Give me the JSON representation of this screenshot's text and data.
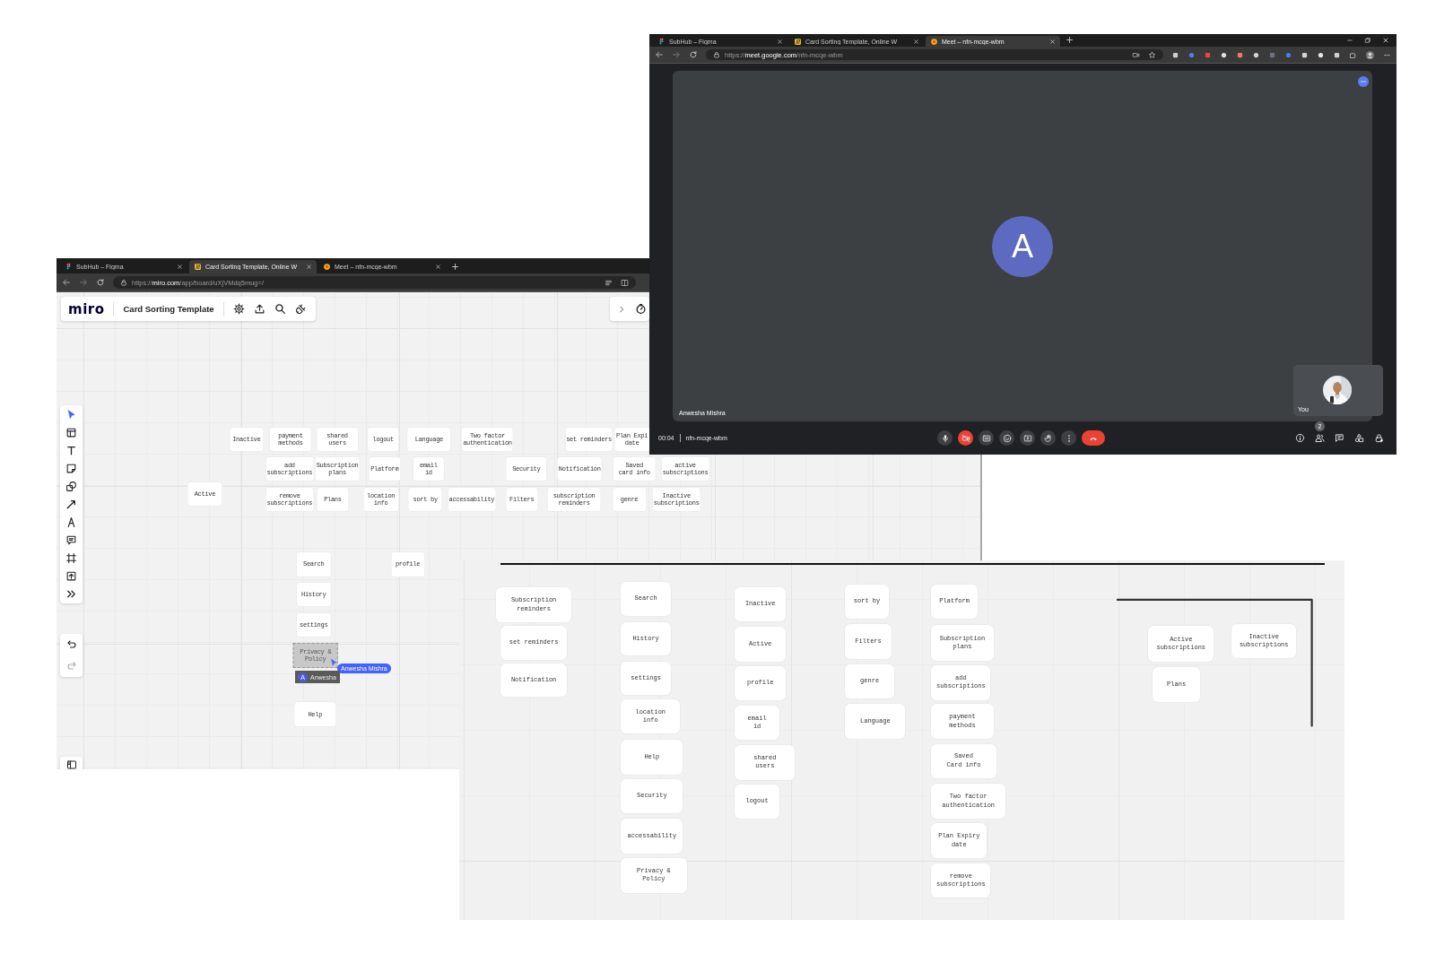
{
  "miro_window": {
    "tabs": [
      {
        "title": "SubHub – Figma",
        "selected": false
      },
      {
        "title": "Card Sorting Template, Online W",
        "selected": true
      },
      {
        "title": "Meet – nfn-mcqe-wbm",
        "selected": false
      }
    ],
    "address": {
      "scheme": "https://",
      "host": "miro.com",
      "path": "/app/board/uXjVMdq5mug=/"
    },
    "logo": "miro",
    "board_title": "Card Sorting Template",
    "cards": [
      {
        "text": "Inactive",
        "selected": false
      },
      {
        "text": "payment\nmethods",
        "selected": false
      },
      {
        "text": "shared\nusers",
        "selected": false
      },
      {
        "text": "logout",
        "selected": false
      },
      {
        "text": "Language",
        "selected": false
      },
      {
        "text": "Two factor\nauthentication",
        "selected": false
      },
      {
        "text": "set reminders",
        "selected": false
      },
      {
        "text": "Plan Expi\ndate",
        "selected": false
      },
      {
        "text": "add\nsubscriptions",
        "selected": false
      },
      {
        "text": "Subscription\nplans",
        "selected": false
      },
      {
        "text": "Platform",
        "selected": false
      },
      {
        "text": "email\nid",
        "selected": false
      },
      {
        "text": "Security",
        "selected": false
      },
      {
        "text": "Notification",
        "selected": false
      },
      {
        "text": "Saved\ncard info",
        "selected": false
      },
      {
        "text": "active\nsubscriptions",
        "selected": false
      },
      {
        "text": "Active",
        "selected": false
      },
      {
        "text": "remove\nsubscriptions",
        "selected": false
      },
      {
        "text": "Plans",
        "selected": false
      },
      {
        "text": "location\ninfo",
        "selected": false
      },
      {
        "text": "sort by",
        "selected": false
      },
      {
        "text": "accessability",
        "selected": false
      },
      {
        "text": "Filters",
        "selected": false
      },
      {
        "text": "subscription\nreminders",
        "selected": false
      },
      {
        "text": "genre",
        "selected": false
      },
      {
        "text": "Inactive\nsubscriptions",
        "selected": false
      },
      {
        "text": "Search",
        "selected": false
      },
      {
        "text": "profile",
        "selected": false
      },
      {
        "text": "History",
        "selected": false
      },
      {
        "text": "settings",
        "selected": false
      },
      {
        "text": "Privacy &\nPolicy",
        "selected": true
      },
      {
        "text": "Help",
        "selected": false
      }
    ],
    "collaborator_cursor": {
      "name": "Anwesha Mishra"
    },
    "collaborator_tag": {
      "initial": "A",
      "name": "Anwesha"
    }
  },
  "meet_window": {
    "tabs": [
      {
        "title": "SubHub – Figma",
        "selected": false
      },
      {
        "title": "Card Sorting Template, Online W",
        "selected": false
      },
      {
        "title": "Meet – nfn-mcqe-wbm",
        "selected": true
      }
    ],
    "address": {
      "scheme": "https://",
      "host": "meet.google.com",
      "path": "/nfn-mcqe-wbm"
    },
    "participant": {
      "initial": "A",
      "name": "Anwesha Mishra"
    },
    "self_tile": {
      "label": "You"
    },
    "time": "00:04",
    "meeting_code": "nfn-mcqe-wbm",
    "camera_on": false,
    "people_count": "2"
  },
  "sorted_board": {
    "cards": [
      {
        "text": "Subscription\nreminders"
      },
      {
        "text": "set reminders"
      },
      {
        "text": "Notification"
      },
      {
        "text": "Search"
      },
      {
        "text": "History"
      },
      {
        "text": "settings"
      },
      {
        "text": "location\ninfo"
      },
      {
        "text": "Help"
      },
      {
        "text": "Security"
      },
      {
        "text": "accessability"
      },
      {
        "text": "Privacy &\nPolicy"
      },
      {
        "text": "Inactive"
      },
      {
        "text": "Active"
      },
      {
        "text": "profile"
      },
      {
        "text": "email\nid"
      },
      {
        "text": "shared\nusers"
      },
      {
        "text": "logout"
      },
      {
        "text": "sort by"
      },
      {
        "text": "Filters"
      },
      {
        "text": "genre"
      },
      {
        "text": "Language"
      },
      {
        "text": "Platform"
      },
      {
        "text": "Subscription\nplans"
      },
      {
        "text": "add\nsubscriptions"
      },
      {
        "text": "payment\nmethods"
      },
      {
        "text": "Saved\nCard info"
      },
      {
        "text": "Two factor\nauthentication"
      },
      {
        "text": "Plan Expiry\ndate"
      },
      {
        "text": "remove\nsubscriptions"
      },
      {
        "text": "Active\nsubscriptions"
      },
      {
        "text": "Inactive\nsubscriptions"
      },
      {
        "text": "Plans"
      }
    ]
  }
}
